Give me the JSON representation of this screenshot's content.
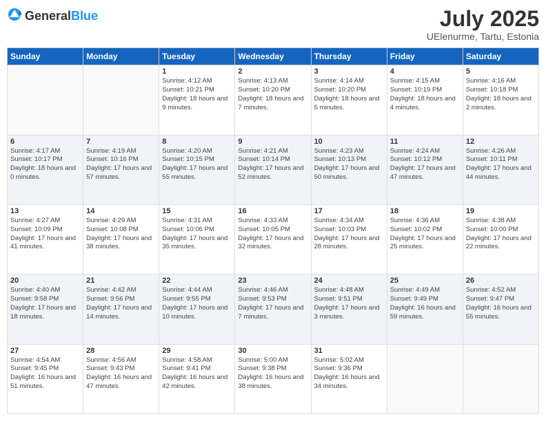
{
  "logo": {
    "general": "General",
    "blue": "Blue"
  },
  "header": {
    "month_year": "July 2025",
    "location": "UElenurme, Tartu, Estonia"
  },
  "columns": [
    "Sunday",
    "Monday",
    "Tuesday",
    "Wednesday",
    "Thursday",
    "Friday",
    "Saturday"
  ],
  "weeks": [
    [
      {
        "day": "",
        "info": ""
      },
      {
        "day": "",
        "info": ""
      },
      {
        "day": "1",
        "info": "Sunrise: 4:12 AM\nSunset: 10:21 PM\nDaylight: 18 hours and 9 minutes."
      },
      {
        "day": "2",
        "info": "Sunrise: 4:13 AM\nSunset: 10:20 PM\nDaylight: 18 hours and 7 minutes."
      },
      {
        "day": "3",
        "info": "Sunrise: 4:14 AM\nSunset: 10:20 PM\nDaylight: 18 hours and 5 minutes."
      },
      {
        "day": "4",
        "info": "Sunrise: 4:15 AM\nSunset: 10:19 PM\nDaylight: 18 hours and 4 minutes."
      },
      {
        "day": "5",
        "info": "Sunrise: 4:16 AM\nSunset: 10:18 PM\nDaylight: 18 hours and 2 minutes."
      }
    ],
    [
      {
        "day": "6",
        "info": "Sunrise: 4:17 AM\nSunset: 10:17 PM\nDaylight: 18 hours and 0 minutes."
      },
      {
        "day": "7",
        "info": "Sunrise: 4:19 AM\nSunset: 10:16 PM\nDaylight: 17 hours and 57 minutes."
      },
      {
        "day": "8",
        "info": "Sunrise: 4:20 AM\nSunset: 10:15 PM\nDaylight: 17 hours and 55 minutes."
      },
      {
        "day": "9",
        "info": "Sunrise: 4:21 AM\nSunset: 10:14 PM\nDaylight: 17 hours and 52 minutes."
      },
      {
        "day": "10",
        "info": "Sunrise: 4:23 AM\nSunset: 10:13 PM\nDaylight: 17 hours and 50 minutes."
      },
      {
        "day": "11",
        "info": "Sunrise: 4:24 AM\nSunset: 10:12 PM\nDaylight: 17 hours and 47 minutes."
      },
      {
        "day": "12",
        "info": "Sunrise: 4:26 AM\nSunset: 10:11 PM\nDaylight: 17 hours and 44 minutes."
      }
    ],
    [
      {
        "day": "13",
        "info": "Sunrise: 4:27 AM\nSunset: 10:09 PM\nDaylight: 17 hours and 41 minutes."
      },
      {
        "day": "14",
        "info": "Sunrise: 4:29 AM\nSunset: 10:08 PM\nDaylight: 17 hours and 38 minutes."
      },
      {
        "day": "15",
        "info": "Sunrise: 4:31 AM\nSunset: 10:06 PM\nDaylight: 17 hours and 35 minutes."
      },
      {
        "day": "16",
        "info": "Sunrise: 4:33 AM\nSunset: 10:05 PM\nDaylight: 17 hours and 32 minutes."
      },
      {
        "day": "17",
        "info": "Sunrise: 4:34 AM\nSunset: 10:03 PM\nDaylight: 17 hours and 28 minutes."
      },
      {
        "day": "18",
        "info": "Sunrise: 4:36 AM\nSunset: 10:02 PM\nDaylight: 17 hours and 25 minutes."
      },
      {
        "day": "19",
        "info": "Sunrise: 4:38 AM\nSunset: 10:00 PM\nDaylight: 17 hours and 22 minutes."
      }
    ],
    [
      {
        "day": "20",
        "info": "Sunrise: 4:40 AM\nSunset: 9:58 PM\nDaylight: 17 hours and 18 minutes."
      },
      {
        "day": "21",
        "info": "Sunrise: 4:42 AM\nSunset: 9:56 PM\nDaylight: 17 hours and 14 minutes."
      },
      {
        "day": "22",
        "info": "Sunrise: 4:44 AM\nSunset: 9:55 PM\nDaylight: 17 hours and 10 minutes."
      },
      {
        "day": "23",
        "info": "Sunrise: 4:46 AM\nSunset: 9:53 PM\nDaylight: 17 hours and 7 minutes."
      },
      {
        "day": "24",
        "info": "Sunrise: 4:48 AM\nSunset: 9:51 PM\nDaylight: 17 hours and 3 minutes."
      },
      {
        "day": "25",
        "info": "Sunrise: 4:49 AM\nSunset: 9:49 PM\nDaylight: 16 hours and 59 minutes."
      },
      {
        "day": "26",
        "info": "Sunrise: 4:52 AM\nSunset: 9:47 PM\nDaylight: 16 hours and 55 minutes."
      }
    ],
    [
      {
        "day": "27",
        "info": "Sunrise: 4:54 AM\nSunset: 9:45 PM\nDaylight: 16 hours and 51 minutes."
      },
      {
        "day": "28",
        "info": "Sunrise: 4:56 AM\nSunset: 9:43 PM\nDaylight: 16 hours and 47 minutes."
      },
      {
        "day": "29",
        "info": "Sunrise: 4:58 AM\nSunset: 9:41 PM\nDaylight: 16 hours and 42 minutes."
      },
      {
        "day": "30",
        "info": "Sunrise: 5:00 AM\nSunset: 9:38 PM\nDaylight: 16 hours and 38 minutes."
      },
      {
        "day": "31",
        "info": "Sunrise: 5:02 AM\nSunset: 9:36 PM\nDaylight: 16 hours and 34 minutes."
      },
      {
        "day": "",
        "info": ""
      },
      {
        "day": "",
        "info": ""
      }
    ]
  ]
}
